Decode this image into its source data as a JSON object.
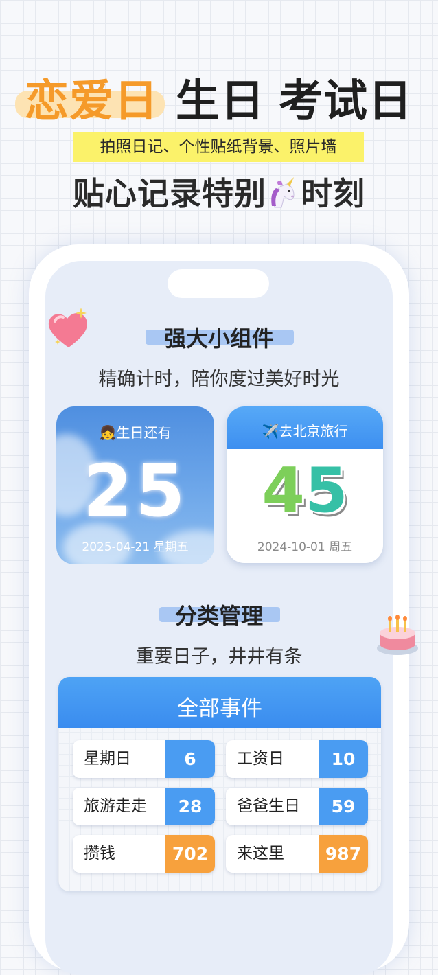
{
  "headline": {
    "love": "恋爱日",
    "birthday": "生日",
    "exam": "考试日"
  },
  "tagline": "拍照日记、个性贴纸背景、照片墙",
  "subtitle": {
    "before": "贴心记录特别",
    "after": "时刻"
  },
  "widgets_section": {
    "title": "强大小组件",
    "subtitle": "精确计时，陪你度过美好时光"
  },
  "widget_birthday": {
    "label": "👧生日还有",
    "days": "25",
    "date": "2025-04-21 星期五"
  },
  "widget_trip": {
    "label": "✈️去北京旅行",
    "digit1": "4",
    "digit2": "5",
    "date": "2024-10-01 周五"
  },
  "category_section": {
    "title": "分类管理",
    "subtitle": "重要日子，井井有条"
  },
  "panel": {
    "title": "全部事件",
    "items": [
      {
        "name": "星期日",
        "count": "6",
        "color": "#4a9cf2"
      },
      {
        "name": "工资日",
        "count": "10",
        "color": "#4a9cf2"
      },
      {
        "name": "旅游走走",
        "count": "28",
        "color": "#4a9cf2"
      },
      {
        "name": "爸爸生日",
        "count": "59",
        "color": "#4a9cf2"
      },
      {
        "name": "攒钱",
        "count": "702",
        "color": "#f7a13d"
      },
      {
        "name": "来这里",
        "count": "987",
        "color": "#f7a13d"
      }
    ]
  },
  "colors": {
    "accent_orange": "#f59a2a",
    "highlight_yellow": "#fbf26a",
    "primary_blue": "#4a9cf2"
  },
  "icons": {
    "unicorn": "unicorn-icon",
    "heart": "heart-icon",
    "cake": "birthday-cake-icon"
  }
}
